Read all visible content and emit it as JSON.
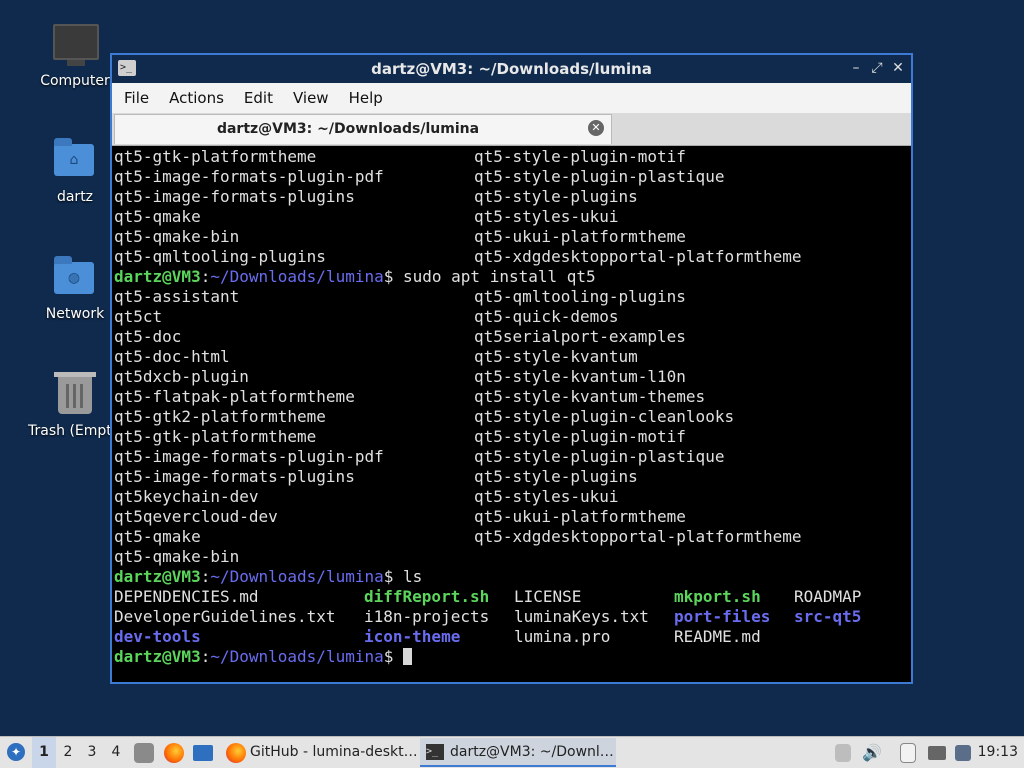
{
  "desktop": {
    "icons": [
      {
        "label": "Computer"
      },
      {
        "label": "dartz"
      },
      {
        "label": "Network"
      },
      {
        "label": "Trash (Empt"
      }
    ]
  },
  "window": {
    "title": "dartz@VM3: ~/Downloads/lumina",
    "menu": [
      "File",
      "Actions",
      "Edit",
      "View",
      "Help"
    ],
    "tab_title": "dartz@VM3: ~/Downloads/lumina"
  },
  "terminal": {
    "prompt_user": "dartz@VM3",
    "prompt_sep": ":",
    "prompt_path": "~/Downloads/lumina",
    "prompt_end": "$ ",
    "top_rows": [
      [
        "qt5-gtk-platformtheme",
        "qt5-style-plugin-motif"
      ],
      [
        "qt5-image-formats-plugin-pdf",
        "qt5-style-plugin-plastique"
      ],
      [
        "qt5-image-formats-plugins",
        "qt5-style-plugins"
      ],
      [
        "qt5-qmake",
        "qt5-styles-ukui"
      ],
      [
        "qt5-qmake-bin",
        "qt5-ukui-platformtheme"
      ],
      [
        "qt5-qmltooling-plugins",
        "qt5-xdgdesktopportal-platformtheme"
      ]
    ],
    "command1": "sudo apt install qt5",
    "completion_rows": [
      [
        "qt5-assistant",
        "qt5-qmltooling-plugins"
      ],
      [
        "qt5ct",
        "qt5-quick-demos"
      ],
      [
        "qt5-doc",
        "qt5serialport-examples"
      ],
      [
        "qt5-doc-html",
        "qt5-style-kvantum"
      ],
      [
        "qt5dxcb-plugin",
        "qt5-style-kvantum-l10n"
      ],
      [
        "qt5-flatpak-platformtheme",
        "qt5-style-kvantum-themes"
      ],
      [
        "qt5-gtk2-platformtheme",
        "qt5-style-plugin-cleanlooks"
      ],
      [
        "qt5-gtk-platformtheme",
        "qt5-style-plugin-motif"
      ],
      [
        "qt5-image-formats-plugin-pdf",
        "qt5-style-plugin-plastique"
      ],
      [
        "qt5-image-formats-plugins",
        "qt5-style-plugins"
      ],
      [
        "qt5keychain-dev",
        "qt5-styles-ukui"
      ],
      [
        "qt5qevercloud-dev",
        "qt5-ukui-platformtheme"
      ],
      [
        "qt5-qmake",
        "qt5-xdgdesktopportal-platformtheme"
      ],
      [
        "qt5-qmake-bin",
        ""
      ]
    ],
    "command2": "ls",
    "ls_rows": [
      [
        {
          "name": "DEPENDENCIES.md",
          "kind": "file"
        },
        {
          "name": "diffReport.sh",
          "kind": "exec"
        },
        {
          "name": "LICENSE",
          "kind": "file"
        },
        {
          "name": "mkport.sh",
          "kind": "exec"
        },
        {
          "name": "ROADMAP",
          "kind": "file"
        }
      ],
      [
        {
          "name": "DeveloperGuidelines.txt",
          "kind": "file"
        },
        {
          "name": "i18n-projects",
          "kind": "file"
        },
        {
          "name": "luminaKeys.txt",
          "kind": "file"
        },
        {
          "name": "port-files",
          "kind": "dir"
        },
        {
          "name": "src-qt5",
          "kind": "dir"
        }
      ],
      [
        {
          "name": "dev-tools",
          "kind": "dir"
        },
        {
          "name": "icon-theme",
          "kind": "dir"
        },
        {
          "name": "lumina.pro",
          "kind": "file"
        },
        {
          "name": "README.md",
          "kind": "file"
        },
        {
          "name": "",
          "kind": "file"
        }
      ]
    ]
  },
  "taskbar": {
    "workspaces": [
      "1",
      "2",
      "3",
      "4"
    ],
    "active_workspace": "1",
    "tasks": [
      {
        "label": "GitHub - lumina-deskt…",
        "icon": "firefox-icon"
      },
      {
        "label": "dartz@VM3: ~/Downl…",
        "icon": "terminal-icon"
      }
    ],
    "clock": "19:13"
  },
  "colors": {
    "desktop_bg": "#0f2a4d",
    "prompt_user": "#5bd55b",
    "prompt_path": "#6a6cf0",
    "window_border": "#3d7ad4"
  }
}
